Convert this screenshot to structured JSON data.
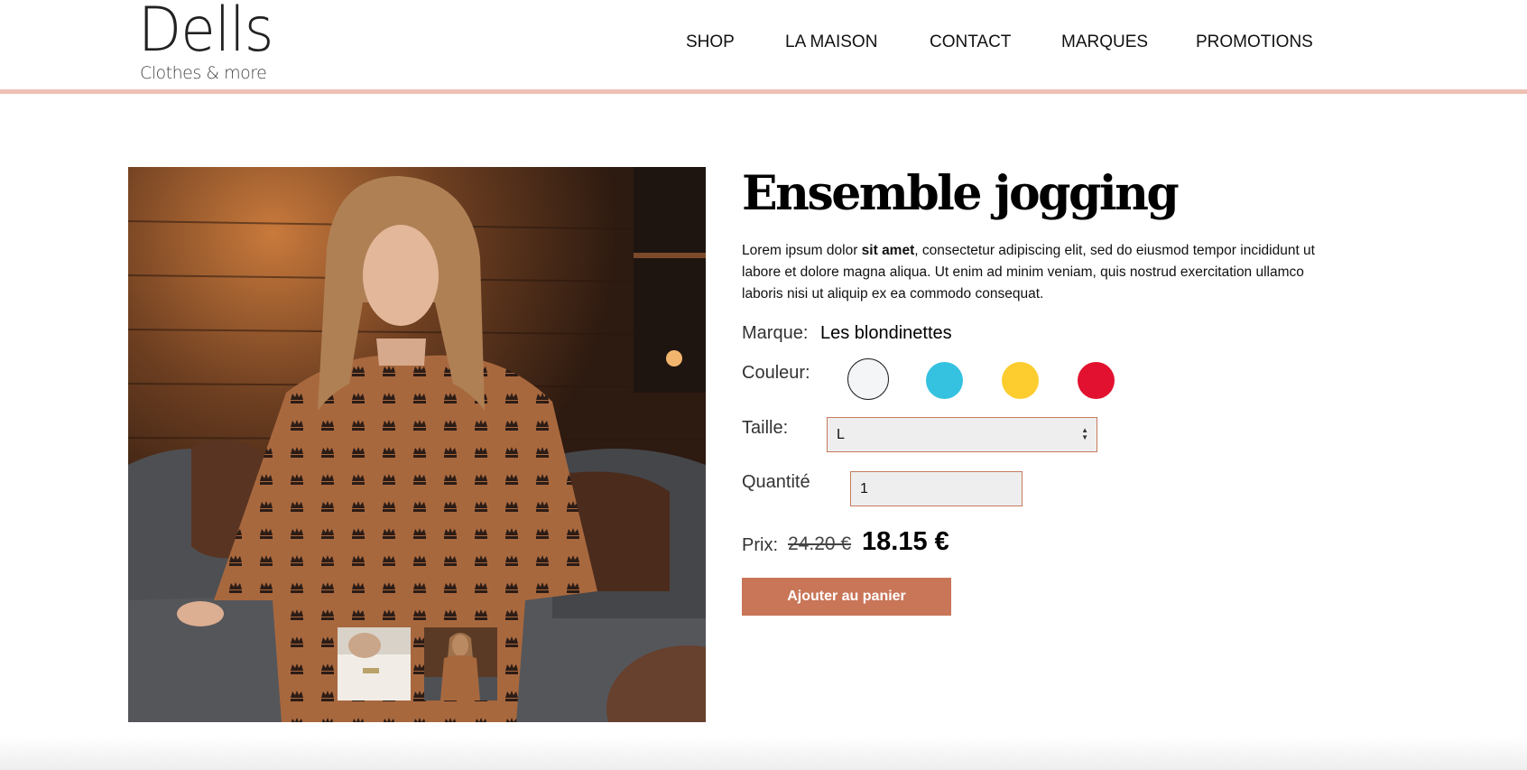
{
  "header": {
    "logo": {
      "name": "Dells",
      "tagline": "Clothes & more"
    },
    "nav": [
      {
        "label": "SHOP"
      },
      {
        "label": "LA MAISON"
      },
      {
        "label": "CONTACT"
      },
      {
        "label": "MARQUES"
      },
      {
        "label": "PROMOTIONS"
      }
    ],
    "accent_line_color": "#edc0b3"
  },
  "product": {
    "title": "Ensemble jogging",
    "description": {
      "before": "Lorem ipsum dolor ",
      "bold": "sit amet",
      "after": ", consectetur adipiscing elit, sed do eiusmod tempor incididunt ut labore et dolore magna aliqua. Ut enim ad minim veniam, quis nostrud exercitation ullamco laboris nisi ut aliquip ex ea commodo consequat."
    },
    "brand_label": "Marque:",
    "brand": "Les blondinettes",
    "color_label": "Couleur:",
    "colors": [
      {
        "hex": "#f4f5f7",
        "selected": true
      },
      {
        "hex": "#35c1e0",
        "selected": false
      },
      {
        "hex": "#fdcd2f",
        "selected": false
      },
      {
        "hex": "#e2112f",
        "selected": false
      }
    ],
    "size_label": "Taille:",
    "size_value": "L",
    "quantity_label": "Quantité",
    "quantity_value": "1",
    "price_label": "Prix:",
    "price_old": "24.20 €",
    "price_new": "18.15 €",
    "add_to_cart": "Ajouter au panier",
    "button_color": "#c97558",
    "thumbnails": [
      {
        "icon": "thumbnail-detail-image"
      },
      {
        "icon": "thumbnail-full-image"
      }
    ]
  }
}
